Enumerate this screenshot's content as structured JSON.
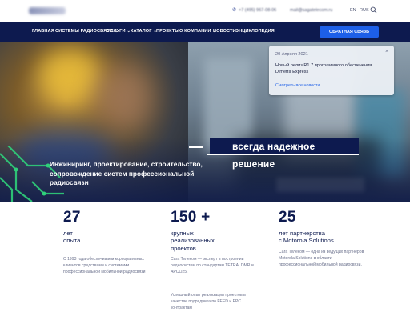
{
  "header": {
    "phone": "+7 (495) 967-08-06",
    "email": "mail@sagatelecom.ru",
    "lang_en": "EN",
    "lang_ru": "RUS"
  },
  "nav": {
    "items": [
      {
        "label": "ГЛАВНАЯ"
      },
      {
        "label": "СИСТЕМЫ РАДИОСВЯЗИ",
        "dropdown": true
      },
      {
        "label": "УСЛУГИ",
        "dropdown": true
      },
      {
        "label": "КАТАЛОГ",
        "dropdown": true
      },
      {
        "label": "ПРОЕКТЫ"
      },
      {
        "label": "О КОМПАНИИ",
        "dropdown": true
      },
      {
        "label": "НОВОСТИ"
      },
      {
        "label": "ЭНЦИКЛОПЕДИЯ"
      }
    ],
    "cta_label": "ОБРАТНАЯ СВЯЗЬ"
  },
  "news_popup": {
    "date": "20 Апреля 2021",
    "title": "Новый релиз R1.7 программного обеспечения Dimetra Express",
    "link": "Смотреть все новости →",
    "close": "×"
  },
  "hero": {
    "slogan": "всегда надежное решение",
    "text": "Инжиниринг, проектирование, строительство, сопровождение систем профессиональной радиосвязи"
  },
  "stats": [
    {
      "number": "27",
      "label": "лет\nопыта",
      "desc": "С 1993 года обеспечиваем корпоративных клиентов средствами и системами профессиональной мобильной радиосвязи"
    },
    {
      "number": "150 +",
      "label": "крупных\nреализованных\nпроектов",
      "desc": "Сага Телеком — эксперт в построении радиосистем по стандартам TETRA, DMR и APCO25.",
      "desc2": "Успешный опыт реализации проектов в качестве подрядчика по FEED и EPC контрактам"
    },
    {
      "number": "25",
      "label": "лет партнерства\nс Motorola Solutions",
      "desc": "Сага Телеком — одна из ведущих партнеров Motorola Solutions в области профессиональной мобильной радиосвязи."
    }
  ],
  "colors": {
    "nav_bg": "#0d1a4f",
    "accent": "#1d5fe8",
    "link": "#2d6ae8"
  }
}
